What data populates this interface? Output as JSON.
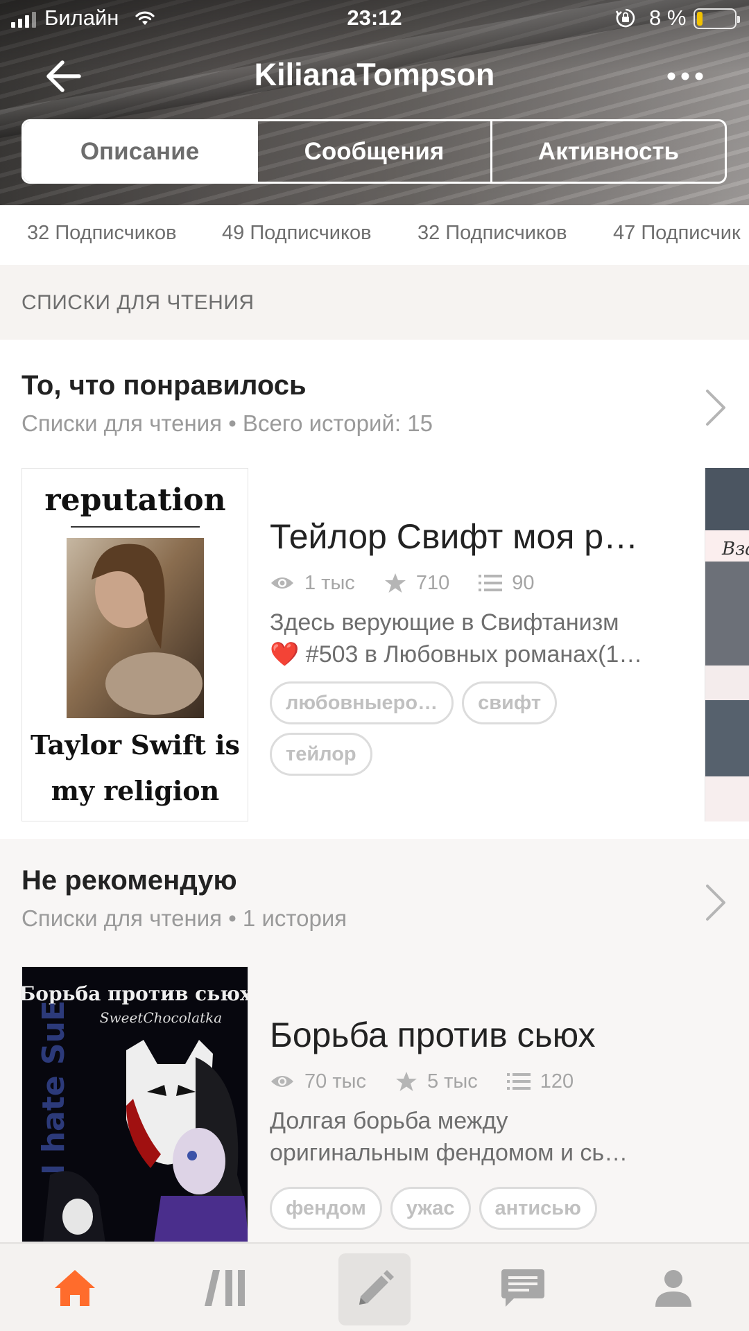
{
  "status_bar": {
    "carrier": "Билайн",
    "time": "23:12",
    "battery": "8 %",
    "battery_level": 0.08
  },
  "header": {
    "title": "KilianaTompson",
    "back_icon": "arrow-left-icon",
    "more_icon": "more-dots-icon",
    "tabs": [
      {
        "label": "Описание",
        "active": true
      },
      {
        "label": "Сообщения",
        "active": false
      },
      {
        "label": "Активность",
        "active": false
      }
    ]
  },
  "followers": [
    "32 Подписчиков",
    "49 Подписчиков",
    "32 Подписчиков",
    "47 Подписчик"
  ],
  "section_title": "СПИСКИ ДЛЯ ЧТЕНИЯ",
  "reading_lists": [
    {
      "title": "То, что понравилось",
      "subtitle": "Списки для чтения • Всего историй: 15",
      "story": {
        "cover_text": {
          "top": "reputation",
          "bottom1": "Taylor Swift is",
          "bottom2": "my religion"
        },
        "title": "Тейлор Свифт моя р…",
        "reads": "1 тыс",
        "votes": "710",
        "parts": "90",
        "desc_line1": "Здесь верующие в Свифтанизм",
        "desc_line2": "❤️ #503 в Любовных романах(1…",
        "tags": [
          "любовныеро…",
          "свифт",
          "тейлор"
        ]
      },
      "next_cover_text": "Вза"
    },
    {
      "title": "Не рекомендую",
      "subtitle": "Списки для чтения • 1 история",
      "story": {
        "cover_text": {
          "top": "Борьба против сьюх",
          "author": "SweetChocolatka",
          "side": "I hate SuE"
        },
        "title": "Борьба против сьюх",
        "reads": "70 тыс",
        "votes": "5 тыс",
        "parts": "120",
        "desc_line1": "Долгая борьба между",
        "desc_line2": "оригинальным фендомом и сь…",
        "tags": [
          "фендом",
          "ужас",
          "антисью"
        ]
      }
    }
  ],
  "bottom_nav": [
    "home-icon",
    "library-icon",
    "write-icon",
    "messages-icon",
    "profile-icon"
  ],
  "colors": {
    "accent": "#ff6c2c",
    "nav_icon": "#a7a7a7",
    "muted_bg": "#f6f3f1"
  }
}
